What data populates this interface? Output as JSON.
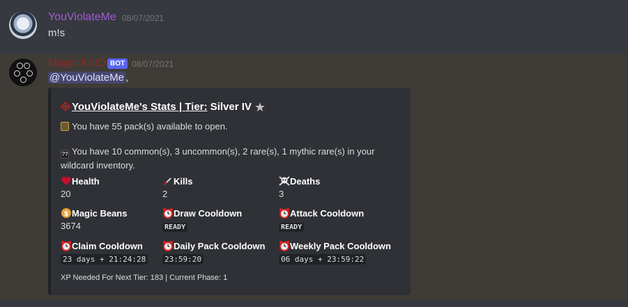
{
  "message1": {
    "username": "YouViolateMe",
    "timestamp": "08/07/2021",
    "content": "m!s"
  },
  "message2": {
    "username": "Magic KotD",
    "bot_tag": "BOT",
    "timestamp": "08/07/2021",
    "mention": "@YouViolateMe",
    "mention_suffix": ",",
    "embed": {
      "title_name": "YouViolateMe's Stats",
      "title_sep": " | ",
      "title_tier_label": "Tier:",
      "title_tier_value": " Silver IV",
      "line1": "You have 55 pack(s) available to open.",
      "line2": "You have 10 common(s), 3 uncommon(s), 2 rare(s), 1 mythic rare(s) in your wildcard inventory.",
      "fields": [
        {
          "name": "Health",
          "value": "20",
          "icon": "heart-icon"
        },
        {
          "name": "Kills",
          "value": "2",
          "icon": "dagger-icon"
        },
        {
          "name": "Deaths",
          "value": "3",
          "icon": "skull-crossbones-icon"
        },
        {
          "name": "Magic Beans",
          "value": "3674",
          "icon": "coin-icon"
        },
        {
          "name": "Draw Cooldown",
          "value": "READY",
          "icon": "alarm-clock-icon"
        },
        {
          "name": "Attack Cooldown",
          "value": "READY",
          "icon": "alarm-clock-icon"
        },
        {
          "name": "Claim Cooldown",
          "value": "23 days + 21:24:28",
          "icon": "alarm-clock-icon"
        },
        {
          "name": "Daily Pack Cooldown",
          "value": "23:59:20",
          "icon": "alarm-clock-icon"
        },
        {
          "name": "Weekly Pack Cooldown",
          "value": "06 days + 23:59:22",
          "icon": "alarm-clock-icon"
        }
      ],
      "footer": "XP Needed For Next Tier: 183 | Current Phase: 1"
    }
  },
  "colors": {
    "background": "#36393f",
    "embed_bg": "#2f3136",
    "username1": "#a35ad8",
    "username2": "#8a2a26",
    "bot_tag": "#5865f2"
  }
}
